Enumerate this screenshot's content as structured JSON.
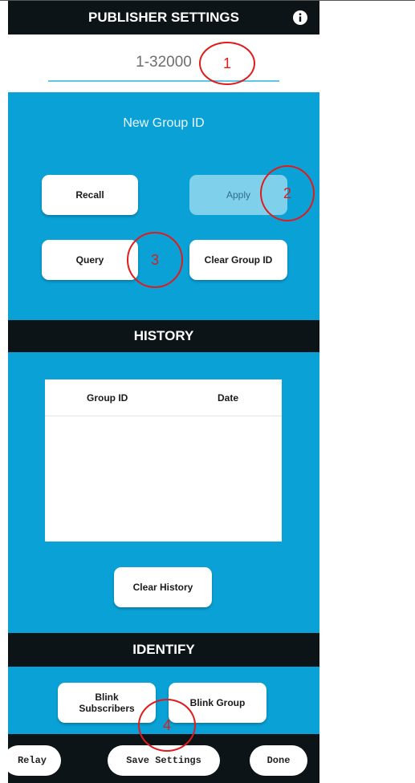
{
  "header": {
    "title": "PUBLISHER SETTINGS",
    "info_icon": "info-circle-icon"
  },
  "group_id_input": {
    "value": "1-32000"
  },
  "new_group": {
    "label": "New Group ID",
    "recall_label": "Recall",
    "apply_label": "Apply",
    "query_label": "Query",
    "clear_group_label": "Clear Group ID"
  },
  "history": {
    "title": "HISTORY",
    "columns": [
      "Group ID",
      "Date"
    ],
    "rows": [],
    "clear_label": "Clear History"
  },
  "identify": {
    "title": "IDENTIFY",
    "blink_subscribers_label": "Blink\nSubscribers",
    "blink_group_label": "Blink Group"
  },
  "footer": {
    "relay_label": "Relay",
    "save_label": "Save Settings",
    "done_label": "Done"
  },
  "annotations": [
    "1",
    "2",
    "3",
    "4"
  ],
  "colors": {
    "dark_bar": "#0d1418",
    "panel_blue": "#0aa2d6",
    "input_underline": "#5fc6e4",
    "annotation_red": "#e11b1b"
  }
}
